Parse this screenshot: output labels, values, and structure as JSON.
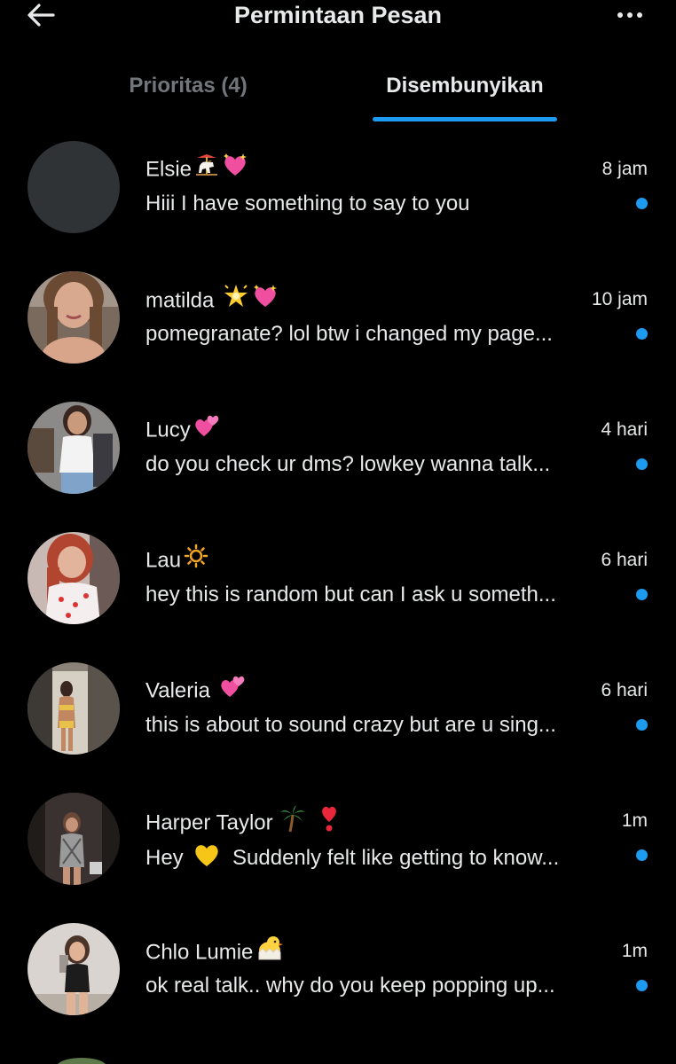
{
  "header": {
    "title": "Permintaan Pesan",
    "back_icon": "arrow-left-icon",
    "more_icon": "more-horizontal-icon"
  },
  "tabs": [
    {
      "label": "Prioritas (4)",
      "active": false
    },
    {
      "label": "Disembunyikan",
      "active": true
    }
  ],
  "colors": {
    "accent": "#1d9bf0",
    "text": "#e7e9ea",
    "muted": "#71767b",
    "background": "#000000"
  },
  "messages": [
    {
      "name": "Elsie",
      "emojis": [
        "carousel-horse-emoji",
        "sparkling-heart-emoji"
      ],
      "time": "8 jam",
      "preview": "Hiii I have something to say to you",
      "unread": true
    },
    {
      "name": "matilda",
      "emojis": [
        "glowing-star-emoji",
        "sparkling-heart-emoji"
      ],
      "time": "10 jam",
      "preview": "pomegranate? lol btw i changed my page...",
      "unread": true
    },
    {
      "name": "Lucy",
      "emojis": [
        "two-hearts-emoji"
      ],
      "time": "4 hari",
      "preview": "do you check ur dms? lowkey wanna talk...",
      "unread": true
    },
    {
      "name": "Lau",
      "emojis": [
        "sun-emoji"
      ],
      "time": "6 hari",
      "preview": "hey this is random but can I ask u someth...",
      "unread": true
    },
    {
      "name": "Valeria",
      "emojis": [
        "two-hearts-emoji"
      ],
      "time": "6 hari",
      "preview": "this is about to sound crazy but are u sing...",
      "unread": true
    },
    {
      "name": "Harper Taylor",
      "emojis": [
        "palm-tree-emoji",
        "exclamation-heart-emoji"
      ],
      "time": "1m",
      "preview_prefix": "Hey",
      "preview_emoji": "yellow-heart-emoji",
      "preview": "Suddenly felt like getting to know...",
      "unread": true
    },
    {
      "name": "Chlo Lumie",
      "emojis": [
        "hatching-chick-emoji"
      ],
      "time": "1m",
      "preview": "ok real talk.. why do you keep popping up...",
      "unread": true
    }
  ]
}
